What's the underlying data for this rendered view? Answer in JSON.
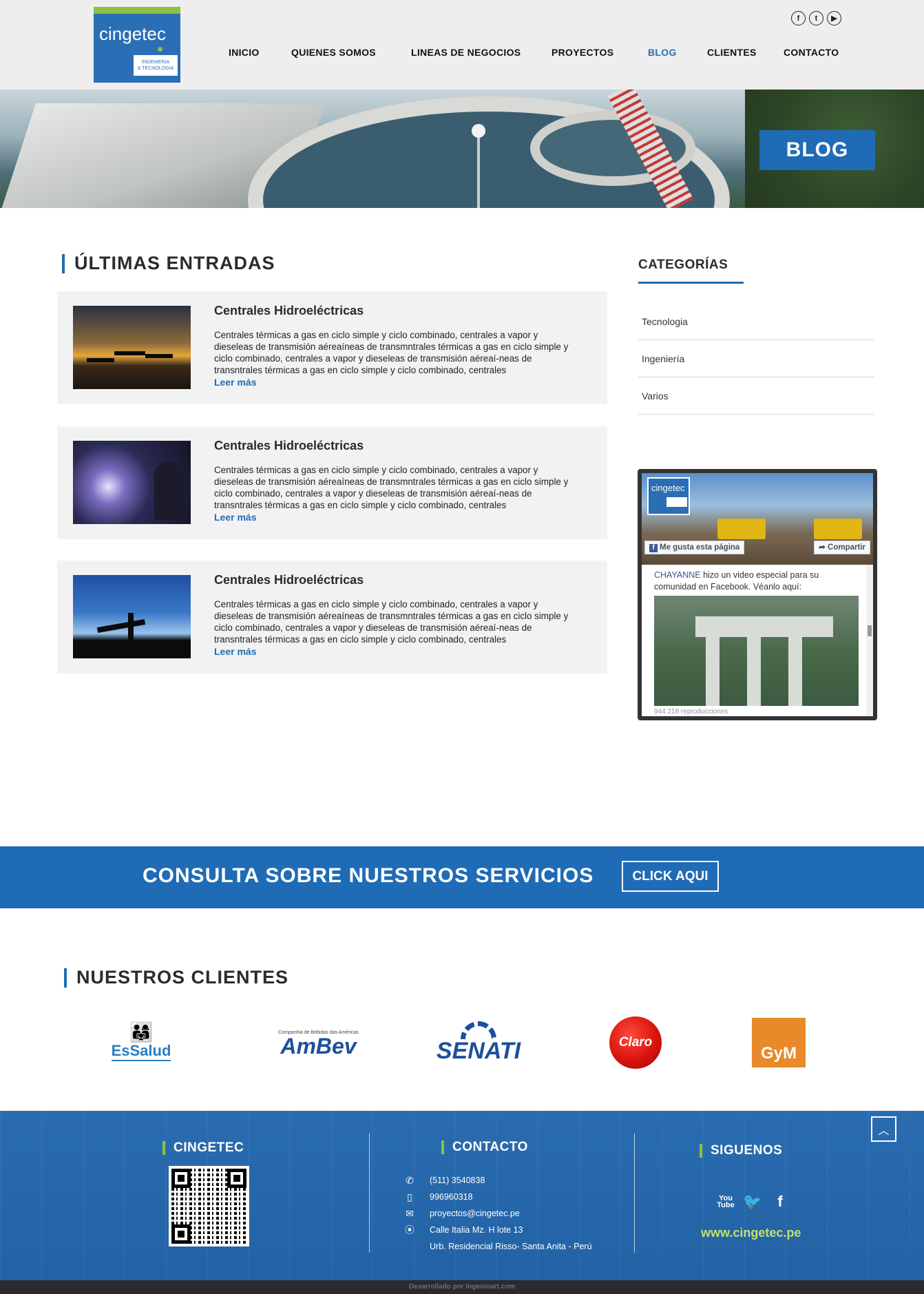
{
  "header": {
    "logo_text": "cingetec",
    "logo_tagline_1": "INGENIERIA",
    "logo_tagline_2": "& TECNOLOGIA",
    "social_icons": [
      "facebook-icon",
      "twitter-icon",
      "youtube-icon"
    ],
    "nav": [
      "INICIO",
      "QUIENES SOMOS",
      "LINEAS DE NEGOCIOS",
      "PROYECTOS",
      "BLOG",
      "CLIENTES",
      "CONTACTO"
    ],
    "active_nav": "BLOG"
  },
  "banner": {
    "badge": "BLOG"
  },
  "posts_section": {
    "title": "ÚLTIMAS ENTRADAS",
    "posts": [
      {
        "title": "Centrales Hidroeléctricas",
        "excerpt": "Centrales térmicas a gas en ciclo simple y ciclo combinado, centrales a vapor y dieseleas de transmisión aéreaíneas de transmntrales térmicas a gas en ciclo simple y ciclo combinado, centrales a vapor y dieseleas de transmisión aéreaí-neas de transntrales térmicas a gas en ciclo simple y ciclo combinado, centrales",
        "more": "Leer más"
      },
      {
        "title": "Centrales Hidroeléctricas",
        "excerpt": "Centrales térmicas a gas en ciclo simple y ciclo combinado, centrales a vapor y dieseleas de transmisión aéreaíneas de transmntrales térmicas a gas en ciclo simple y ciclo combinado, centrales a vapor y dieseleas de transmisión aéreaí-neas de transntrales térmicas a gas en ciclo simple y ciclo combinado, centrales",
        "more": "Leer más"
      },
      {
        "title": "Centrales Hidroeléctricas",
        "excerpt": "Centrales térmicas a gas en ciclo simple y ciclo combinado, centrales a vapor y dieseleas de transmisión aéreaíneas de transmntrales térmicas a gas en ciclo simple y ciclo combinado, centrales a vapor y dieseleas de transmisión aéreaí-neas de transntrales térmicas a gas en ciclo simple y ciclo combinado, centrales",
        "more": "Leer más"
      }
    ]
  },
  "sidebar": {
    "categories_title": "CATEGORÍAS",
    "categories": [
      "Tecnologia",
      "Ingeniería",
      "Varios"
    ],
    "facebook": {
      "page_name": "cingetec",
      "like_label": "Me gusta esta página",
      "share_label": "Compartir",
      "post_author": "CHAYANNE",
      "post_text": " hizo un video especial para su comunidad en Facebook. Véanlo aquí:",
      "views": "944 218 reproducciones"
    }
  },
  "cta": {
    "text": "CONSULTA SOBRE NUESTROS SERVICIOS",
    "button": "CLICK AQUI"
  },
  "clients": {
    "title": "NUESTROS CLIENTES",
    "logos": [
      {
        "name": "EsSalud"
      },
      {
        "name": "AmBev",
        "subtitle": "Companhia de Bebidas das Américas"
      },
      {
        "name": "SENATI"
      },
      {
        "name": "Claro"
      },
      {
        "name": "GyM"
      }
    ]
  },
  "footer": {
    "col1_title": "CINGETEC",
    "col2_title": "CONTACTO",
    "col3_title": "SIGUENOS",
    "phone": "(511) 3540838",
    "mobile": "996960318",
    "email": "proyectos@cingetec.pe",
    "address_1": "Calle Italia Mz. H lote 13",
    "address_2": "Urb. Residencial Risso- Santa Anita - Perú",
    "website": "www.cingetec.pe",
    "social_icons": [
      "youtube-icon",
      "twitter-icon",
      "facebook-icon"
    ],
    "credit": "Desarrollado por Ingenioart.com"
  },
  "colors": {
    "brand_blue": "#1f6bb6",
    "brand_green": "#8dc13f"
  }
}
